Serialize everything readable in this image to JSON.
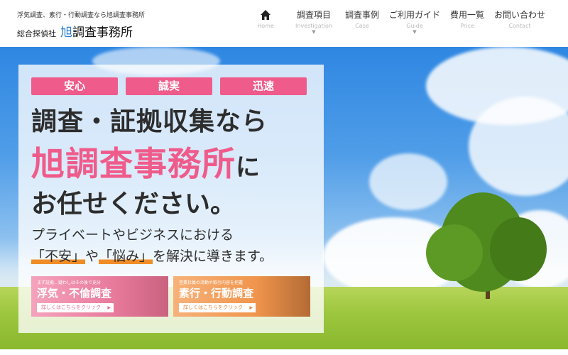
{
  "header": {
    "tagline": "浮気調査、素行・行動調査なら旭調査事務所",
    "company_kind": "総合探偵社",
    "brand_first": "旭",
    "brand_rest": "調査事務所"
  },
  "nav": {
    "home_en": "Home",
    "items": [
      {
        "jp": "調査項目",
        "en": "Investigation"
      },
      {
        "jp": "調査事例",
        "en": "Case"
      },
      {
        "jp": "ご利用ガイド",
        "en": "Guide"
      },
      {
        "jp": "費用一覧",
        "en": "Price"
      },
      {
        "jp": "お問い合わせ",
        "en": "Contact"
      }
    ],
    "home_icon": "home-icon",
    "caret_icon": "chevron-down-icon"
  },
  "hero": {
    "pills": [
      "安心",
      "誠実",
      "迅速"
    ],
    "headline1": "調査・証拠収集なら",
    "headline2_brand": "旭調査事務所",
    "headline2_suffix": "に",
    "headline3": "お任せください。",
    "sub1": "プライベートやビジネスにおける",
    "sub2_q1": "「不安」",
    "sub2_mid": "や",
    "sub2_q2": "「悩み」",
    "sub2_end": "を解決に導きます。"
  },
  "cards": [
    {
      "small": "まず証拠…疑わしはその後で充分",
      "title": "浮気・不倫調査",
      "cta": "詳しくはこちらをクリック"
    },
    {
      "small": "営業社員の活動や取引内容を把握",
      "title": "素行・行動調査",
      "cta": "詳しくはこちらをクリック"
    }
  ],
  "colors": {
    "accent_pink": "#ef5b8a",
    "accent_orange": "#f08d28",
    "sky": "#2f87e2"
  }
}
